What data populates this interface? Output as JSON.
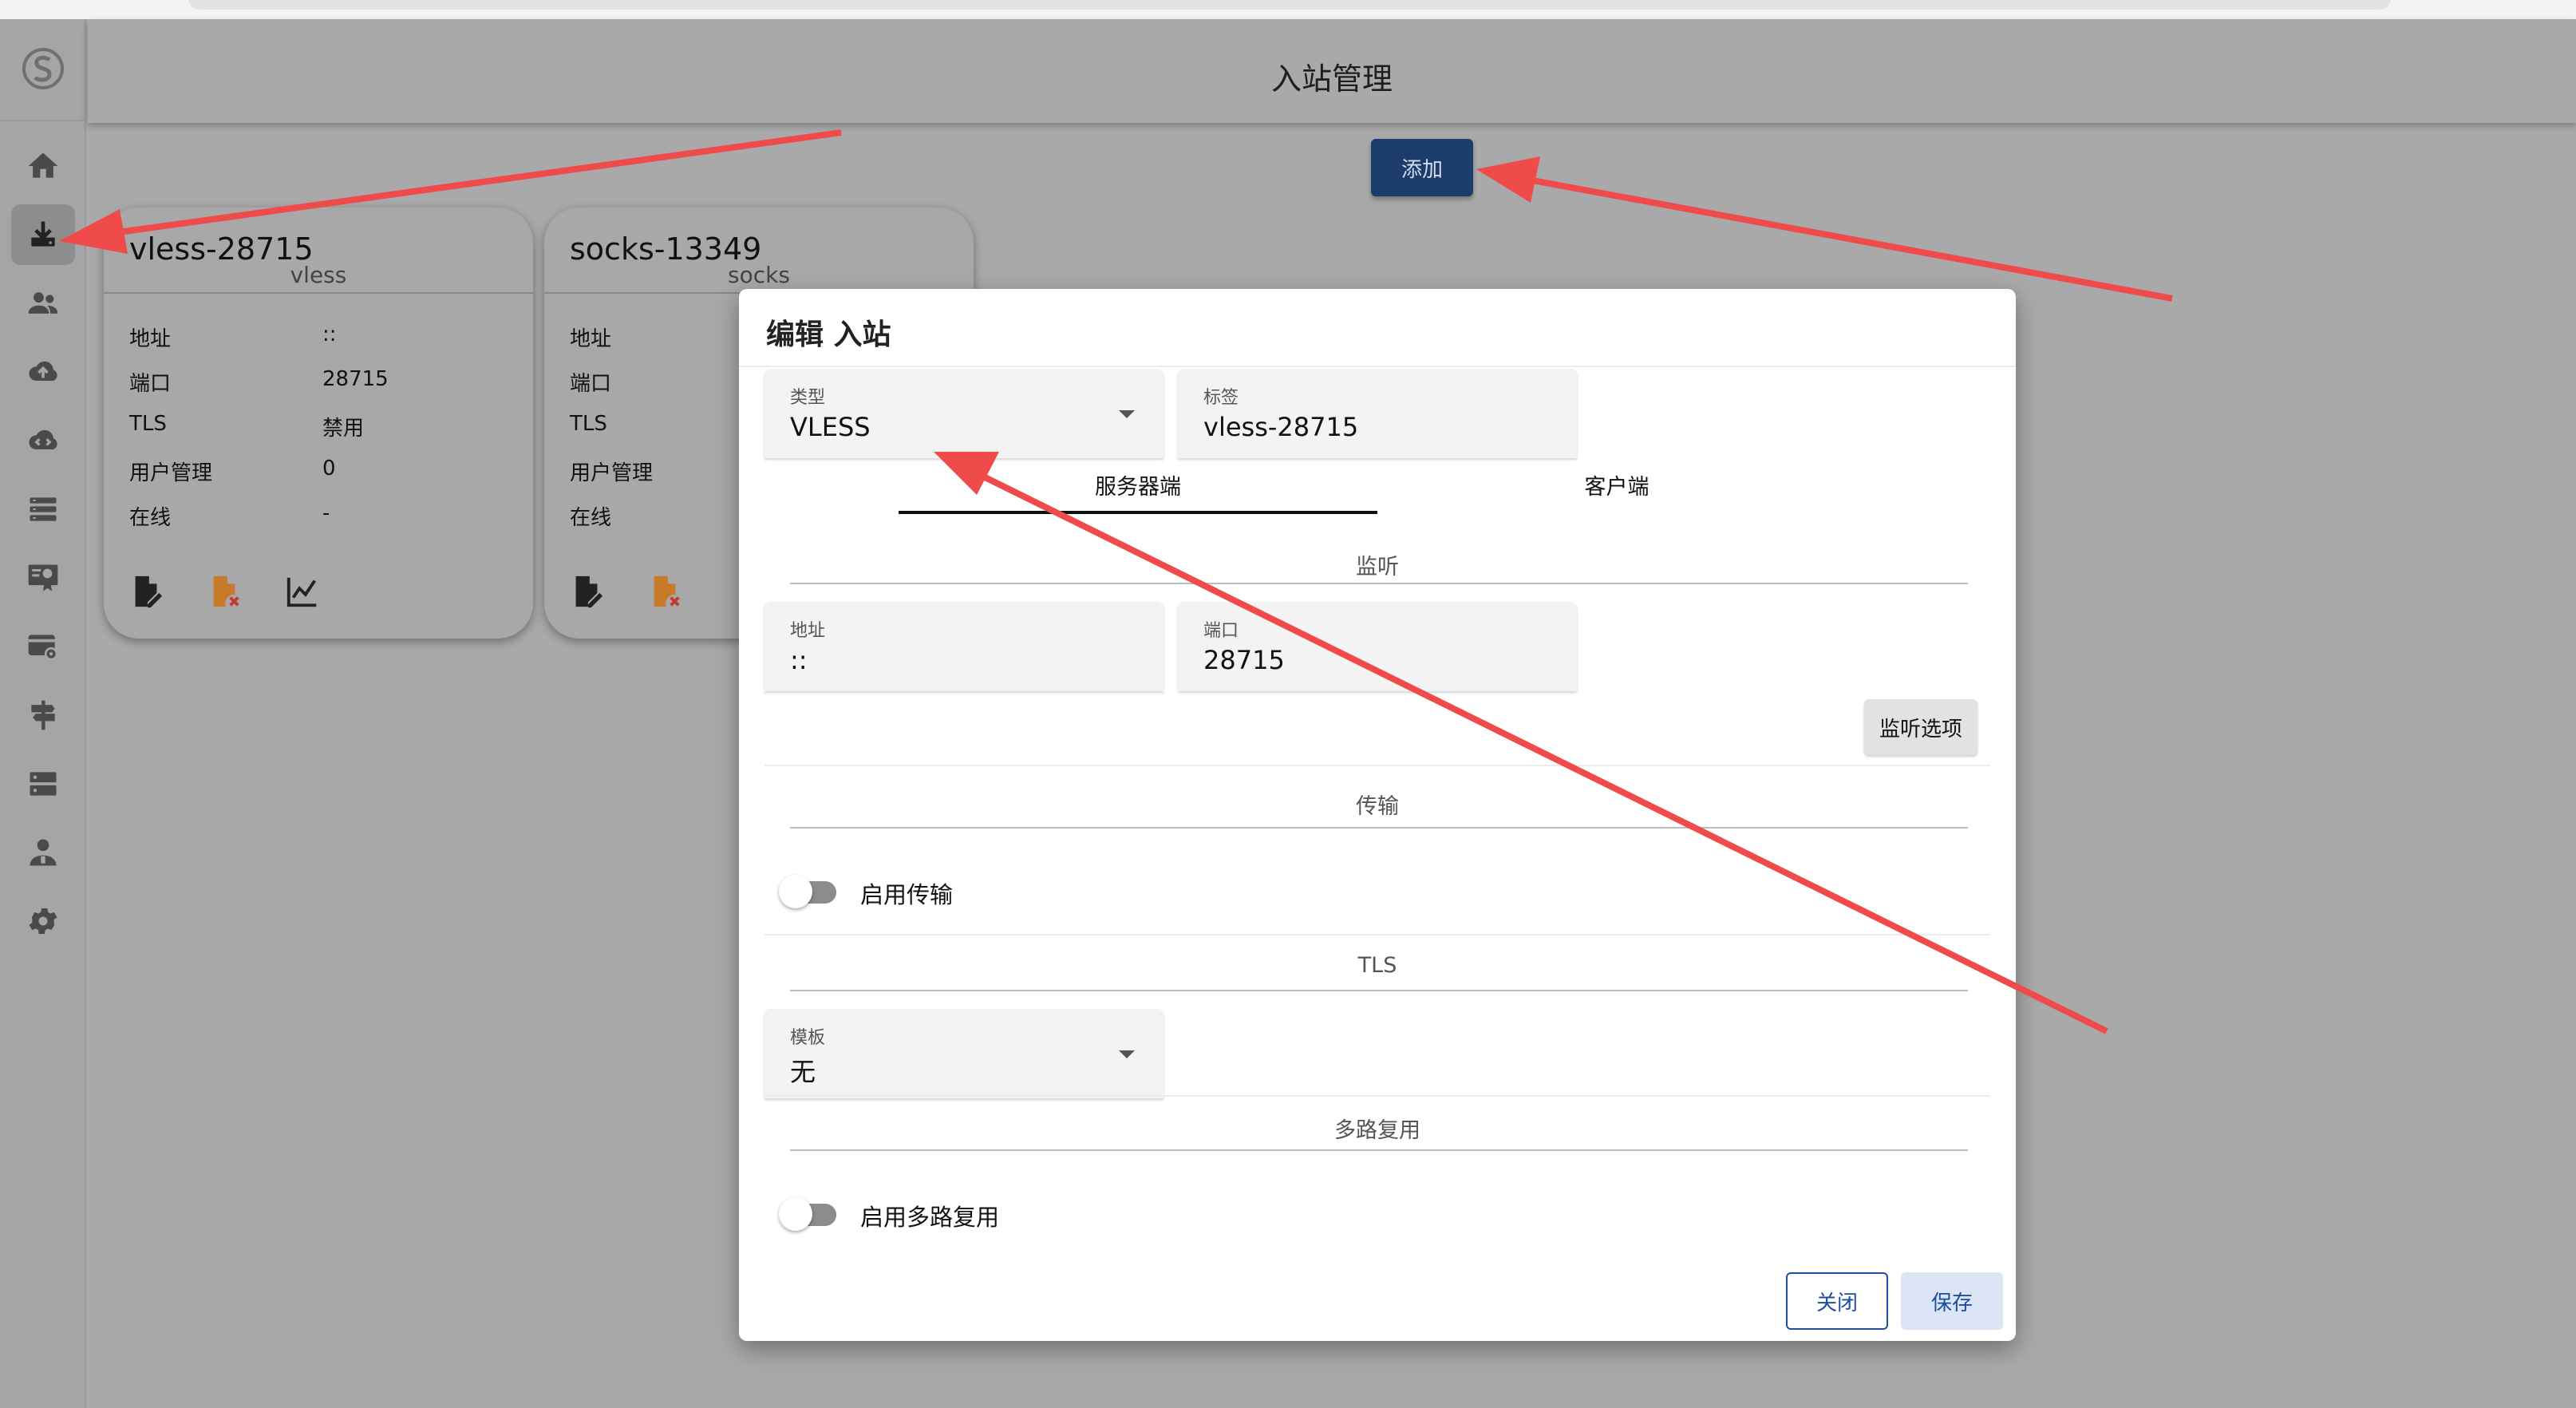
{
  "header": {
    "title": "入站管理"
  },
  "toolbar": {
    "add_label": "添加"
  },
  "sidebar": {
    "items": [
      {
        "icon": "home-icon",
        "active": false
      },
      {
        "icon": "inbound-download-icon",
        "active": true
      },
      {
        "icon": "users-icon",
        "active": false
      },
      {
        "icon": "cloud-upload-icon",
        "active": false
      },
      {
        "icon": "cloud-sync-icon",
        "active": false
      },
      {
        "icon": "list-icon",
        "active": false
      },
      {
        "icon": "certificate-icon",
        "active": false
      },
      {
        "icon": "settings-card-icon",
        "active": false
      },
      {
        "icon": "signpost-icon",
        "active": false
      },
      {
        "icon": "server-icon",
        "active": false
      },
      {
        "icon": "admin-user-icon",
        "active": false
      },
      {
        "icon": "gear-icon",
        "active": false
      }
    ]
  },
  "cards": [
    {
      "title": "vless-28715",
      "subtitle": "vless",
      "rows": [
        {
          "key": "地址",
          "value": "::"
        },
        {
          "key": "端口",
          "value": "28715"
        },
        {
          "key": "TLS",
          "value": "禁用"
        },
        {
          "key": "用户管理",
          "value": "0"
        },
        {
          "key": "在线",
          "value": "-"
        }
      ]
    },
    {
      "title": "socks-13349",
      "subtitle": "socks",
      "rows": [
        {
          "key": "地址",
          "value": ""
        },
        {
          "key": "端口",
          "value": ""
        },
        {
          "key": "TLS",
          "value": ""
        },
        {
          "key": "用户管理",
          "value": ""
        },
        {
          "key": "在线",
          "value": ""
        }
      ]
    }
  ],
  "dialog": {
    "title": "编辑 入站",
    "type_field": {
      "label": "类型",
      "value": "VLESS"
    },
    "tag_field": {
      "label": "标签",
      "value": "vless-28715"
    },
    "tabs": [
      "服务器端",
      "客户端"
    ],
    "listen_section": "监听",
    "address_field": {
      "label": "地址",
      "value": "::"
    },
    "port_field": {
      "label": "端口",
      "value": "28715"
    },
    "listen_options_label": "监听选项",
    "transport_section": "传输",
    "transport_toggle_label": "启用传输",
    "transport_enabled": false,
    "tls_section": "TLS",
    "template_field": {
      "label": "模板",
      "value": "无"
    },
    "mux_section": "多路复用",
    "mux_toggle_label": "启用多路复用",
    "mux_enabled": false,
    "close_label": "关闭",
    "save_label": "保存"
  },
  "colors": {
    "primary": "#1d3c6e",
    "accent_blue": "#1d4e9e",
    "annotation_arrow": "#f04b4b",
    "action_orange": "#c77a2a"
  }
}
